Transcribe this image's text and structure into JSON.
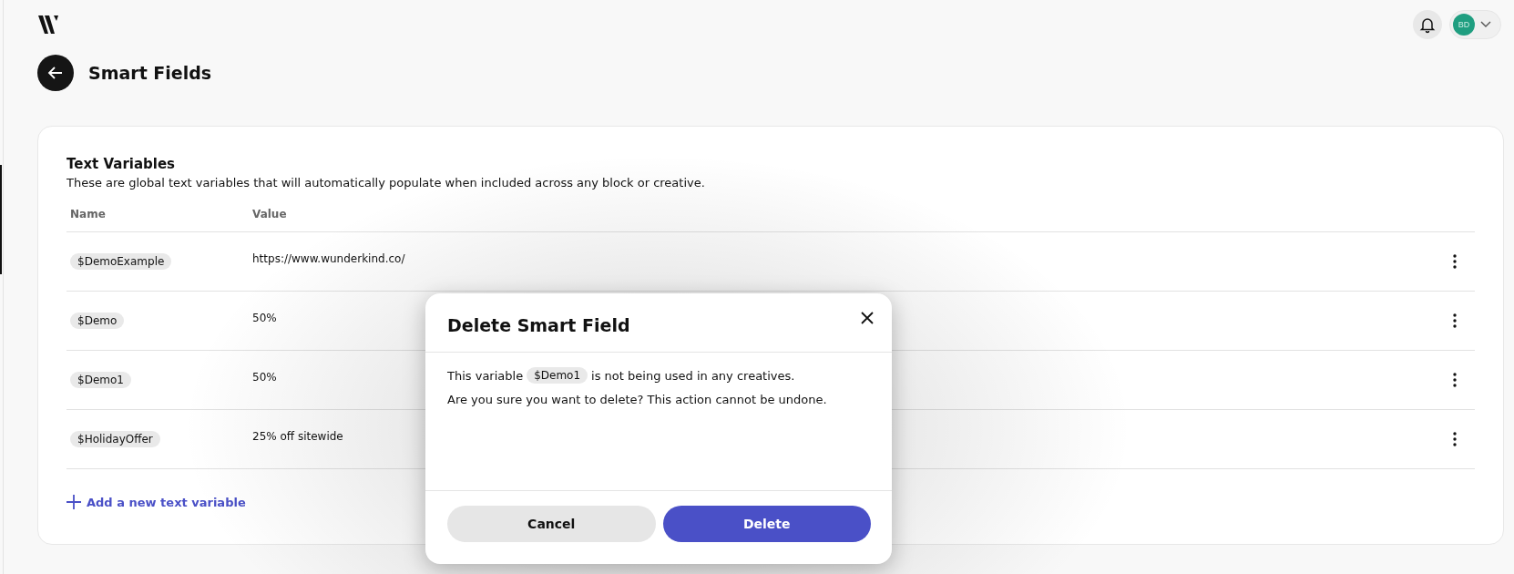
{
  "header": {
    "avatar_initials": "BD"
  },
  "page": {
    "title": "Smart Fields"
  },
  "section": {
    "title": "Text Variables",
    "description": "These are global text variables that will automatically populate when included across any block or creative."
  },
  "table": {
    "columns": [
      "Name",
      "Value"
    ],
    "rows": [
      {
        "name": "$DemoExample",
        "value": "https://www.wunderkind.co/"
      },
      {
        "name": "$Demo",
        "value": "50%"
      },
      {
        "name": "$Demo1",
        "value": "50%"
      },
      {
        "name": "$HolidayOffer",
        "value": "25% off sitewide"
      }
    ]
  },
  "add_link": "Add a new text variable",
  "dialog": {
    "title": "Delete Smart Field",
    "message_before": "This variable",
    "variable": "$Demo1",
    "message_after": "is not being used in any creatives.",
    "confirm_text": "Are you sure you want to delete? This action cannot be undone.",
    "buttons": [
      {
        "label": "Cancel",
        "kind": "secondary"
      },
      {
        "label": "Delete",
        "kind": "primary"
      }
    ]
  }
}
